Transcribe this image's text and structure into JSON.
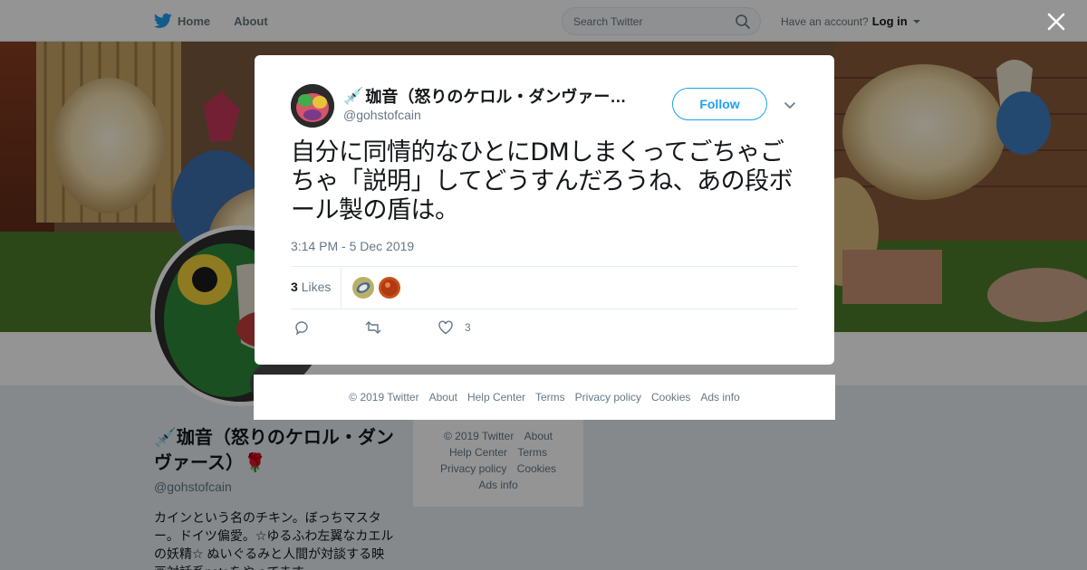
{
  "topbar": {
    "nav": [
      {
        "label": "Home",
        "icon": "twitter-bird-icon"
      },
      {
        "label": "About"
      }
    ],
    "search_placeholder": "Search Twitter",
    "account_prompt": "Have an account?",
    "login_label": "Log in"
  },
  "profile": {
    "display_name": "💉珈音（怒りのケロル・ダンヴァース）🌹",
    "handle": "@gohstofcain",
    "bio": "カインという名のチキン。ぼっちマスター。ドイツ偏愛。☆ゆるふわ左翼なカエルの妖精☆ ぬいぐるみと人間が対談する映画対話系noteをやってます"
  },
  "sidebar_footer": {
    "lines": [
      [
        "© 2019 Twitter",
        "About"
      ],
      [
        "Help Center",
        "Terms"
      ],
      [
        "Privacy policy",
        "Cookies"
      ],
      [
        "Ads info"
      ]
    ]
  },
  "tweet": {
    "name": "珈音（怒りのケロル・ダンヴァー…",
    "name_emoji": "💉",
    "handle": "@gohstofcain",
    "follow_label": "Follow",
    "text": "自分に同情的なひとにDMしまくってごちゃごちゃ「説明」してどうすんだろうね、あの段ボール製の盾は。",
    "timestamp": "3:14 PM - 5 Dec 2019",
    "likes_count": "3",
    "likes_label": "Likes",
    "actions": {
      "reply_icon": "reply-icon",
      "retweet_icon": "retweet-icon",
      "like_icon": "heart-icon",
      "like_count": "3"
    }
  },
  "modal_footer": {
    "links": [
      "© 2019 Twitter",
      "About",
      "Help Center",
      "Terms",
      "Privacy policy",
      "Cookies",
      "Ads info"
    ]
  },
  "colors": {
    "accent": "#1da1f2",
    "text_secondary": "#657786",
    "overlay": "rgba(0,0,0,0.42)"
  }
}
